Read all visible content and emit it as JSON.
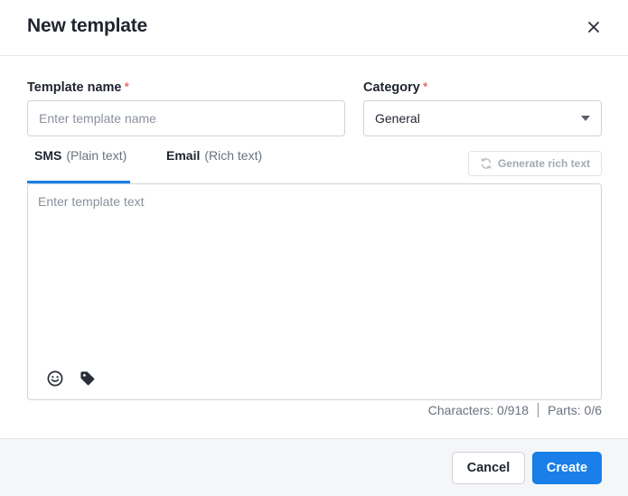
{
  "dialog": {
    "title": "New template",
    "close_icon": "close-icon"
  },
  "form": {
    "template_name": {
      "label": "Template name",
      "required_mark": "*",
      "value": "",
      "placeholder": "Enter template name"
    },
    "category": {
      "label": "Category",
      "required_mark": "*",
      "selected": "General"
    }
  },
  "tabs": [
    {
      "label": "SMS",
      "sublabel": "(Plain text)",
      "active": true
    },
    {
      "label": "Email",
      "sublabel": "(Rich text)",
      "active": false
    }
  ],
  "generate_button": {
    "label": "Generate rich text",
    "icon": "refresh-icon",
    "disabled": true
  },
  "editor": {
    "value": "",
    "placeholder": "Enter template text",
    "toolbar_icons": [
      "emoji-icon",
      "tag-icon"
    ]
  },
  "counter": {
    "characters": "Characters: 0/918",
    "parts": "Parts: 0/6"
  },
  "footer": {
    "cancel_label": "Cancel",
    "create_label": "Create"
  },
  "colors": {
    "primary": "#1a7fe8",
    "required": "#d9534f",
    "border": "#cfd3da",
    "footer_bg": "#f5f6f8"
  }
}
